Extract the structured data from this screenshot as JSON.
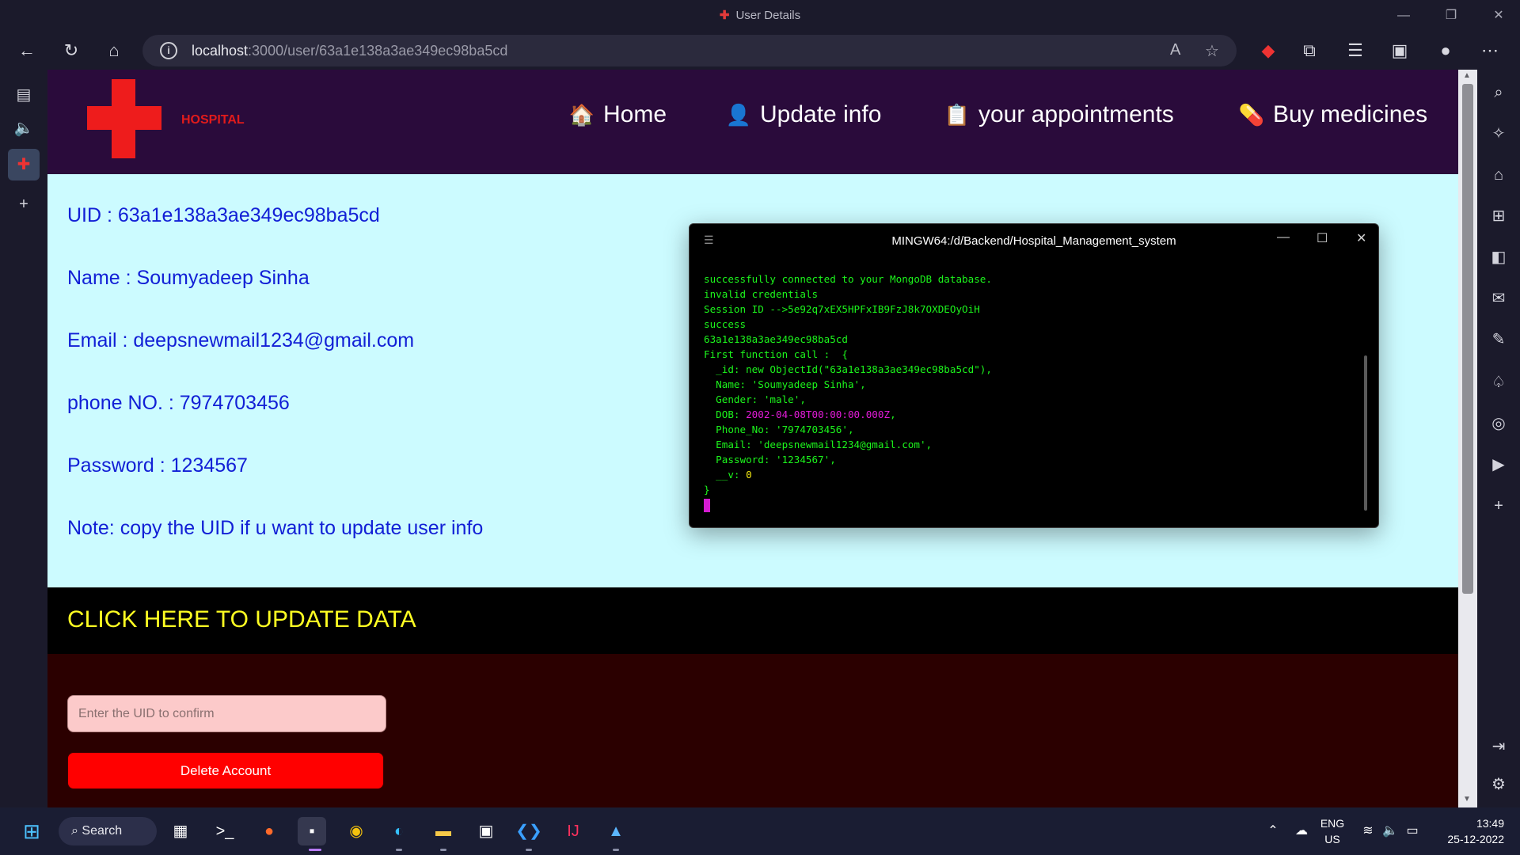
{
  "browser": {
    "window_title": "User Details",
    "url_host": "localhost",
    "url_rest": ":3000/user/63a1e138a3ae349ec98ba5cd"
  },
  "site": {
    "logo_text": "HOSPITAL",
    "nav": [
      {
        "emoji": "🏠",
        "label": "Home"
      },
      {
        "emoji": "👤",
        "label": "Update info"
      },
      {
        "emoji": "📋",
        "label": "your appointments"
      },
      {
        "emoji": "💊",
        "label": "Buy medicines"
      }
    ]
  },
  "user": {
    "uid_line": "UID : 63a1e138a3ae349ec98ba5cd",
    "name_line": "Name : Soumyadeep Sinha",
    "email_line": "Email : deepsnewmail1234@gmail.com",
    "phone_line": "phone NO. : 7974703456",
    "password_line": "Password : 1234567",
    "note_line": "Note: copy the UID if u want to update user info"
  },
  "terminal": {
    "title": "MINGW64:/d/Backend/Hospital_Management_system",
    "lines": {
      "l1": "successfully connected to your MongoDB database.",
      "l2": "invalid credentials",
      "l3": "Session ID -->5e92q7xEX5HPFxIB9FzJ8k7OXDEOyOiH",
      "l4": "success",
      "l5": "63a1e138a3ae349ec98ba5cd",
      "l6": "First function call :  {",
      "l7": "  _id: new ObjectId(\"63a1e138a3ae349ec98ba5cd\"),",
      "l8": "  Name: 'Soumyadeep Sinha',",
      "l9": "  Gender: 'male',",
      "l10a": "  DOB: ",
      "l10b": "2002-04-08T00:00:00.000Z",
      "l10c": ",",
      "l11": "  Phone_No: '7974703456',",
      "l12": "  Email: 'deepsnewmail1234@gmail.com',",
      "l13": "  Password: '1234567',",
      "l14a": "  __v: ",
      "l14b": "0",
      "l15": "}"
    }
  },
  "update_banner": "CLICK HERE TO UPDATE DATA",
  "delete_form": {
    "uid_placeholder": "Enter the UID to confirm",
    "delete_label": "Delete Account"
  },
  "taskbar": {
    "search_label": "Search",
    "lang_top": "ENG",
    "lang_bottom": "US",
    "time": "13:49",
    "date": "25-12-2022"
  },
  "colors": {
    "header_bg": "#2a0b3b",
    "panel_bg": "#ccfbff",
    "info_text": "#1220d6",
    "banner_text": "#ffff22",
    "delete_bg": "#2b0000",
    "delete_button": "#ff0000",
    "logo_red": "#ee1c1c"
  }
}
